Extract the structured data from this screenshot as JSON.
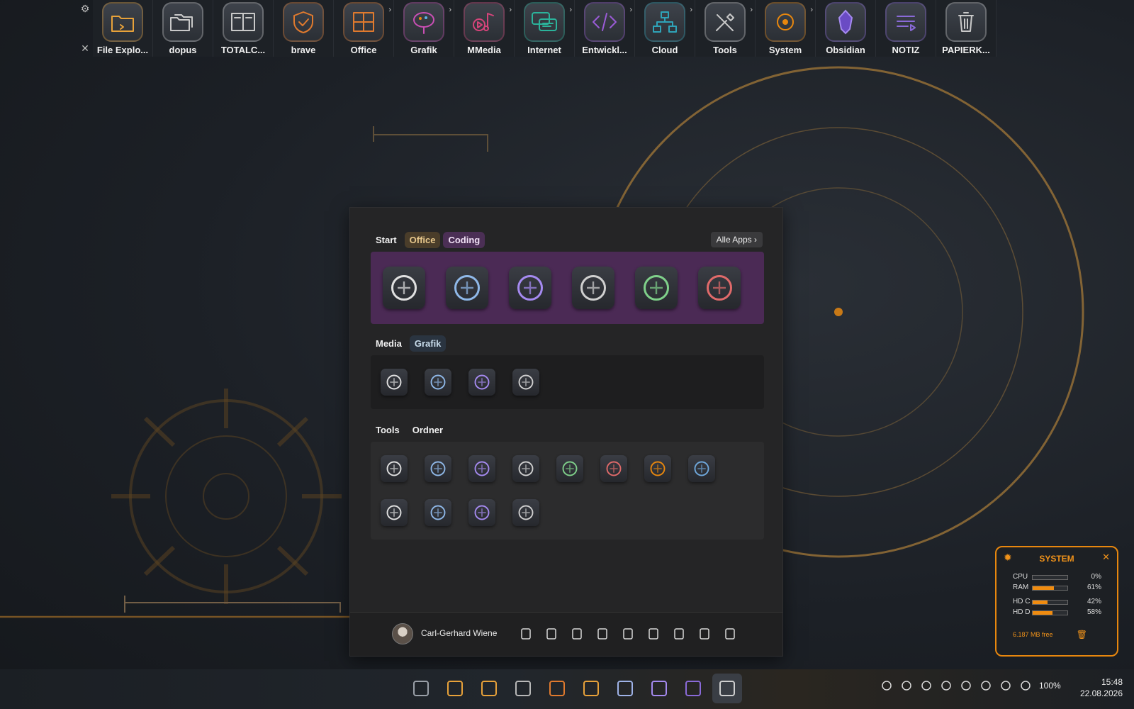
{
  "dock": {
    "settings_icon": "gear-icon",
    "close_icon": "close-icon",
    "items": [
      {
        "label": "File Explo...",
        "icon": "folder-icon",
        "accent": "#e8a23a",
        "has_arrow": false
      },
      {
        "label": "dopus",
        "icon": "folders-icon",
        "accent": "#c9c9c9",
        "has_arrow": false
      },
      {
        "label": "TOTALC...",
        "icon": "split-panel-icon",
        "accent": "#c9c9c9",
        "has_arrow": false
      },
      {
        "label": "brave",
        "icon": "shield-check-icon",
        "accent": "#e07a2e",
        "has_arrow": false
      },
      {
        "label": "Office",
        "icon": "grid-icon",
        "accent": "#e07a2e",
        "has_arrow": true
      },
      {
        "label": "Grafik",
        "icon": "palette-icon",
        "accent": "#c94fb4",
        "has_arrow": true
      },
      {
        "label": "MMedia",
        "icon": "media-icon",
        "accent": "#d4447a",
        "has_arrow": true
      },
      {
        "label": "Internet",
        "icon": "chat-icon",
        "accent": "#2bb39b",
        "has_arrow": true
      },
      {
        "label": "Entwickl...",
        "icon": "code-icon",
        "accent": "#9a5bd6",
        "has_arrow": true
      },
      {
        "label": "Cloud",
        "icon": "network-icon",
        "accent": "#2fa3b8",
        "has_arrow": true
      },
      {
        "label": "Tools",
        "icon": "tools-icon",
        "accent": "#c9c9c9",
        "has_arrow": true
      },
      {
        "label": "System",
        "icon": "system-gear-icon",
        "accent": "#e8870e",
        "has_arrow": true
      },
      {
        "label": "Obsidian",
        "icon": "obsidian-icon",
        "accent": "#8a6ad8",
        "has_arrow": false
      },
      {
        "label": "NOTIZ",
        "icon": "notes-icon",
        "accent": "#8a6ad8",
        "has_arrow": false
      },
      {
        "label": "PAPIERK...",
        "icon": "trash-icon",
        "accent": "#c9c9c9",
        "has_arrow": false
      }
    ]
  },
  "start_menu": {
    "tabs_top": [
      {
        "label": "Start",
        "style": "plain"
      },
      {
        "label": "Office",
        "style": "office"
      },
      {
        "label": "Coding",
        "style": "coding"
      }
    ],
    "alle_apps": "Alle Apps",
    "coding_apps": [
      "openai-icon",
      "arc-icon",
      "kilo-code-icon",
      "git-graph-icon",
      "html-file-icon",
      "access-db-icon"
    ],
    "tabs_mid": [
      {
        "label": "Media",
        "style": "plain"
      },
      {
        "label": "Grafik",
        "style": "grafik"
      }
    ],
    "media_apps": [
      "audio-tape-icon",
      "media-info-icon",
      "chart-arrow-icon",
      "download-box-icon"
    ],
    "tabs_bottom": [
      {
        "label": "Tools",
        "style": "plain"
      },
      {
        "label": "Ordner",
        "style": "plain"
      }
    ],
    "tools_apps_row1": [
      "task-manager-icon",
      "wrench-icon",
      "terminal-icon",
      "powershell-icon",
      "sync-icon",
      "presentation-icon",
      "disk-pie-icon",
      "restore-icon"
    ],
    "tools_apps_row2": [
      "gauge-icon",
      "folder-tools-icon",
      "terminal-alt-icon",
      "control-panel-icon"
    ],
    "footer": {
      "user_name": "Carl-Gerhard Wiene",
      "icons": [
        "document-icon",
        "download-icon",
        "music-icon",
        "image-icon",
        "folder-user-icon",
        "sliders-icon",
        "settings-icon",
        "explorer-icon",
        "power-icon"
      ]
    }
  },
  "system_widget": {
    "title": "SYSTEM",
    "rows": [
      {
        "name": "CPU",
        "value": "0%",
        "fraction": 0.0
      },
      {
        "name": "RAM",
        "value": "61%",
        "fraction": 0.61
      },
      {
        "name": "HD C",
        "value": "42%",
        "fraction": 0.42
      },
      {
        "name": "HD D",
        "value": "58%",
        "fraction": 0.58
      }
    ],
    "free_text": "6.187 MB free",
    "accent": "#f0921a"
  },
  "taskbar": {
    "icons": [
      "windows-icon",
      "explorer-home-icon",
      "file-explorer-icon",
      "dopus-icon",
      "brave-icon",
      "mail-icon",
      "mail-alt-icon",
      "vpn-shield-icon",
      "obsidian-icon",
      "settings-gear-icon"
    ],
    "tray": [
      "chevron-up-icon",
      "chrome-icon",
      "teams-icon",
      "dopus-tray-icon",
      "obsidian-tray-icon",
      "wifi-icon",
      "volume-icon",
      "battery-icon"
    ],
    "battery": "100%",
    "time": "15:48",
    "date": "22.08.2026"
  }
}
